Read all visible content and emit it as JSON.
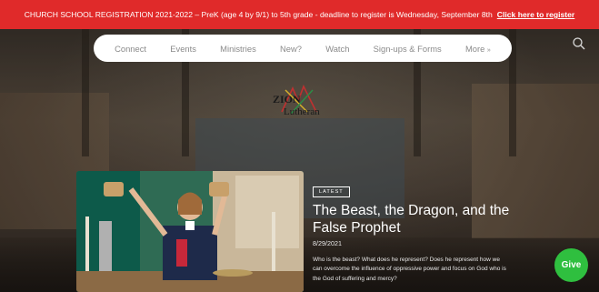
{
  "banner": {
    "text": "CHURCH SCHOOL REGISTRATION 2021-2022 – PreK (age 4 by 9/1) to 5th grade - deadline to register is Wednesday, September 8th",
    "link": "Click here to register"
  },
  "nav": {
    "items": [
      "Connect",
      "Events",
      "Ministries",
      "New?",
      "Watch",
      "Sign-ups & Forms"
    ],
    "more": "More"
  },
  "logo": {
    "line1": "ZION",
    "line2": "Lutheran"
  },
  "featured": {
    "badge": "LATEST",
    "title": "The Beast, the Dragon, and the False Prophet",
    "date": "8/29/2021",
    "excerpt": "Who is the beast? What does he represent? Does he represent how we can overcome the influence of oppressive power and focus on God who is the God of suffering and mercy?"
  },
  "give_label": "Give",
  "colors": {
    "banner": "#e02a2a",
    "give": "#2fbf3f"
  }
}
